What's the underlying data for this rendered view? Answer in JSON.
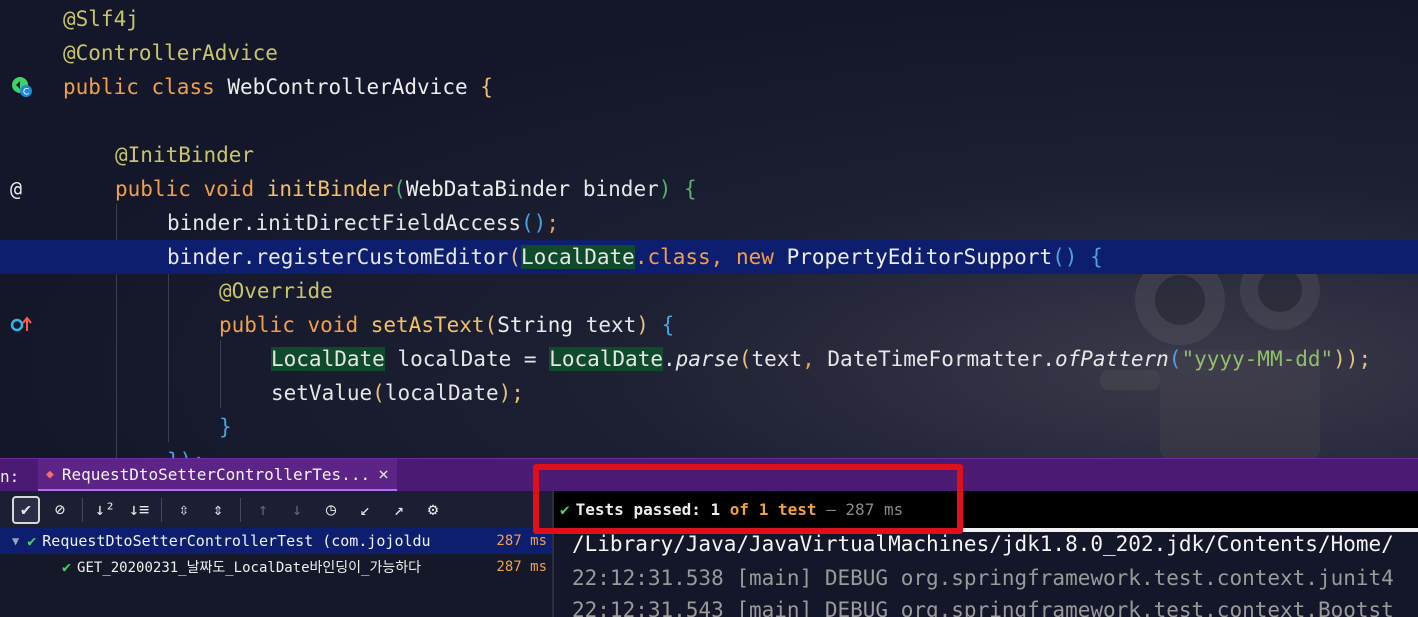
{
  "editor": {
    "lines": {
      "l1": "@Slf4j",
      "l2": "@ControllerAdvice",
      "l3_kw1": "public",
      "l3_kw2": "class",
      "l3_name": "WebControllerAdvice",
      "l3_brace": "{",
      "l5": "@InitBinder",
      "l6_kw1": "public",
      "l6_kw2": "void",
      "l6_fn": "initBinder",
      "l6_open": "(",
      "l6_type": "WebDataBinder",
      "l6_param": "binder",
      "l6_close": ")",
      "l6_brace": "{",
      "l7_obj": "binder.initDirectFieldAccess",
      "l7_paren": "()",
      "l7_semi": ";",
      "l8_obj": "binder.registerCustomEditor",
      "l8_open": "(",
      "l8_type": "LocalDate",
      "l8_class": ".class,",
      "l8_new": "new",
      "l8_ctor": "PropertyEditorSupport",
      "l8_paren": "()",
      "l8_brace": "{",
      "l9": "@Override",
      "l10_kw1": "public",
      "l10_kw2": "void",
      "l10_fn": "setAsText",
      "l10_open": "(",
      "l10_type": "String",
      "l10_param": "text",
      "l10_close": ")",
      "l10_brace": "{",
      "l11_type": "LocalDate",
      "l11_var": "localDate =",
      "l11_type2": "LocalDate",
      "l11_dot": ".",
      "l11_parse": "parse",
      "l11_open": "(",
      "l11_text": "text",
      "l11_comma": ",",
      "l11_fmt": "DateTimeFormatter.",
      "l11_ofp": "ofPattern",
      "l11_open2": "(",
      "l11_str": "\"yyyy-MM-dd\"",
      "l11_close": "));",
      "l12_call": "setValue",
      "l12_open": "(",
      "l12_arg": "localDate",
      "l12_close": ");",
      "l13": "}",
      "l14": "});"
    },
    "gutter_icons": [
      "controller-bean-icon",
      "at-sign-icon",
      "override-method-icon"
    ],
    "gutter_at": "@"
  },
  "run_panel": {
    "tab_prefix": "n:",
    "tab_label": "RequestDtoSetterControllerTes...",
    "tab_close": "×",
    "toolbar_icons": [
      "show-passed-icon",
      "show-ignored-icon",
      "sort-alpha-icon",
      "sort-duration-icon",
      "expand-all-icon",
      "collapse-all-icon",
      "prev-failed-icon",
      "next-failed-icon",
      "history-icon",
      "import-tests-icon",
      "export-tests-icon",
      "settings-icon"
    ],
    "status": {
      "prefix": "Tests passed:",
      "count": "1",
      "of": "of",
      "total": "1 test",
      "dash": "–",
      "time": "287 ms"
    },
    "tree": [
      {
        "label": "RequestDtoSetterControllerTest (com.jojoldu",
        "duration": "287 ms"
      },
      {
        "label": "GET_20200231_날짜도_LocalDate바인딩이_가능하다",
        "duration": "287 ms"
      }
    ],
    "console": {
      "path": "/Library/Java/JavaVirtualMachines/jdk1.8.0_202.jdk/Contents/Home/",
      "log1": "22:12:31.538 [main] DEBUG org.springframework.test.context.junit4",
      "log2": "22:12:31.543 [main] DEBUG org.springframework.test.context.Bootst"
    }
  },
  "colors": {
    "keyword": "#f0a04b",
    "annotation": "#c9c46a",
    "string": "#8fbf6a",
    "pass_green": "#3ed26b",
    "highlight_box": "#e0101b",
    "tab_bar": "#4b1a73"
  }
}
